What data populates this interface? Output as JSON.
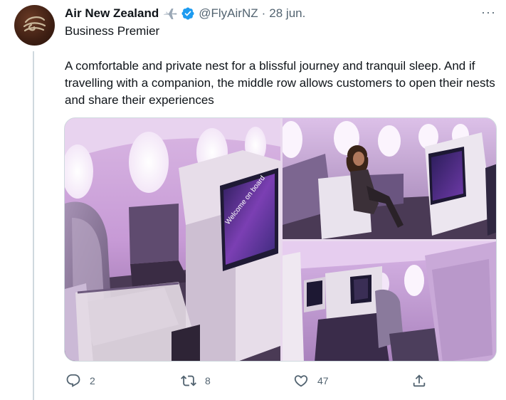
{
  "tweet": {
    "author": {
      "display_name": "Air New Zealand",
      "handle": "@FlyAirNZ",
      "separator": "·",
      "date": "28 jun.",
      "verified": true
    },
    "subtitle": "Business Premier",
    "text": "A comfortable and private nest for a blissful journey and tranquil sleep. And if travelling with a companion, the middle row allows customers to open their nests and share their experiences",
    "media": {
      "screen_text": "Welcome on board"
    },
    "actions": {
      "reply_count": "2",
      "retweet_count": "8",
      "like_count": "47"
    },
    "more_label": "···"
  },
  "colors": {
    "text_primary": "#0f1419",
    "text_secondary": "#536471",
    "verified_blue": "#1d9bf0",
    "cabin_purple": "#b48ac8",
    "divider": "#cfd9de"
  },
  "icons": [
    "avatar-logo",
    "plane-emoji-icon",
    "verified-icon",
    "more-icon",
    "reply-icon",
    "retweet-icon",
    "like-icon",
    "share-icon"
  ]
}
